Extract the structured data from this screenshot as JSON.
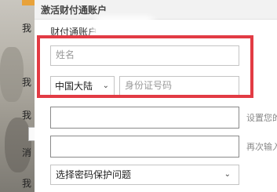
{
  "background": {
    "texts": [
      "我",
      "我",
      "我",
      "消",
      "我"
    ]
  },
  "dialog": {
    "title": "激活财付通账户",
    "account_label": "财付通账户",
    "name_placeholder": "姓名",
    "region_value": "中国大陆",
    "id_placeholder": "身份证号码",
    "password_hint": "设置您的",
    "password_confirm_hint": "再次输入",
    "security_question_value": "选择密码保护问题"
  },
  "colors": {
    "highlight_box": "#e23b44"
  }
}
